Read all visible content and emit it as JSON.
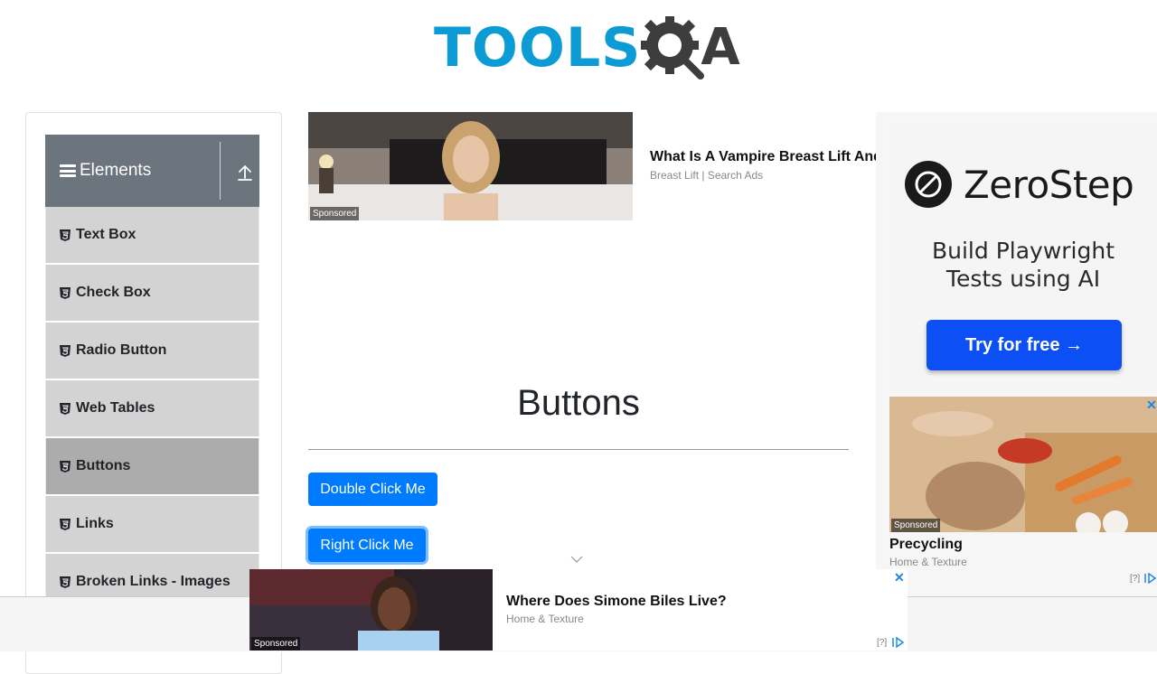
{
  "logo": {
    "text_primary": "TOOLS",
    "text_secondary": "A",
    "icon": "gear-magnifier-icon"
  },
  "sidebar": {
    "group_title": "Elements",
    "items": [
      {
        "label": "Text Box",
        "active": false
      },
      {
        "label": "Check Box",
        "active": false
      },
      {
        "label": "Radio Button",
        "active": false
      },
      {
        "label": "Web Tables",
        "active": false
      },
      {
        "label": "Buttons",
        "active": true
      },
      {
        "label": "Links",
        "active": false
      },
      {
        "label": "Broken Links - Images",
        "active": false
      }
    ]
  },
  "ads": {
    "top": {
      "sponsored": "Sponsored",
      "title": "What Is A Vampire Breast Lift And",
      "source": "Breast Lift | Search Ads"
    },
    "zerostep": {
      "brand": "ZeroStep",
      "headline_1": "Build Playwright",
      "headline_2": "Tests using AI",
      "cta": "Try for free →"
    },
    "precycling": {
      "sponsored": "Sponsored",
      "title": "Precycling",
      "source": "Home & Texture",
      "adchoice": "[?]",
      "close": "✕"
    },
    "bottom": {
      "sponsored": "Sponsored",
      "title": "Where Does Simone Biles Live?",
      "source": "Home & Texture",
      "adchoice": "[?]",
      "close": "✕"
    }
  },
  "main": {
    "title": "Buttons",
    "double_click_label": "Double Click Me",
    "right_click_label": "Right Click Me"
  },
  "colors": {
    "primary": "#007bff",
    "logo_blue": "#0d9bd6",
    "sidebar_header": "#6c757d",
    "menu_bg": "#d3d3d3",
    "menu_active": "#acacac"
  }
}
